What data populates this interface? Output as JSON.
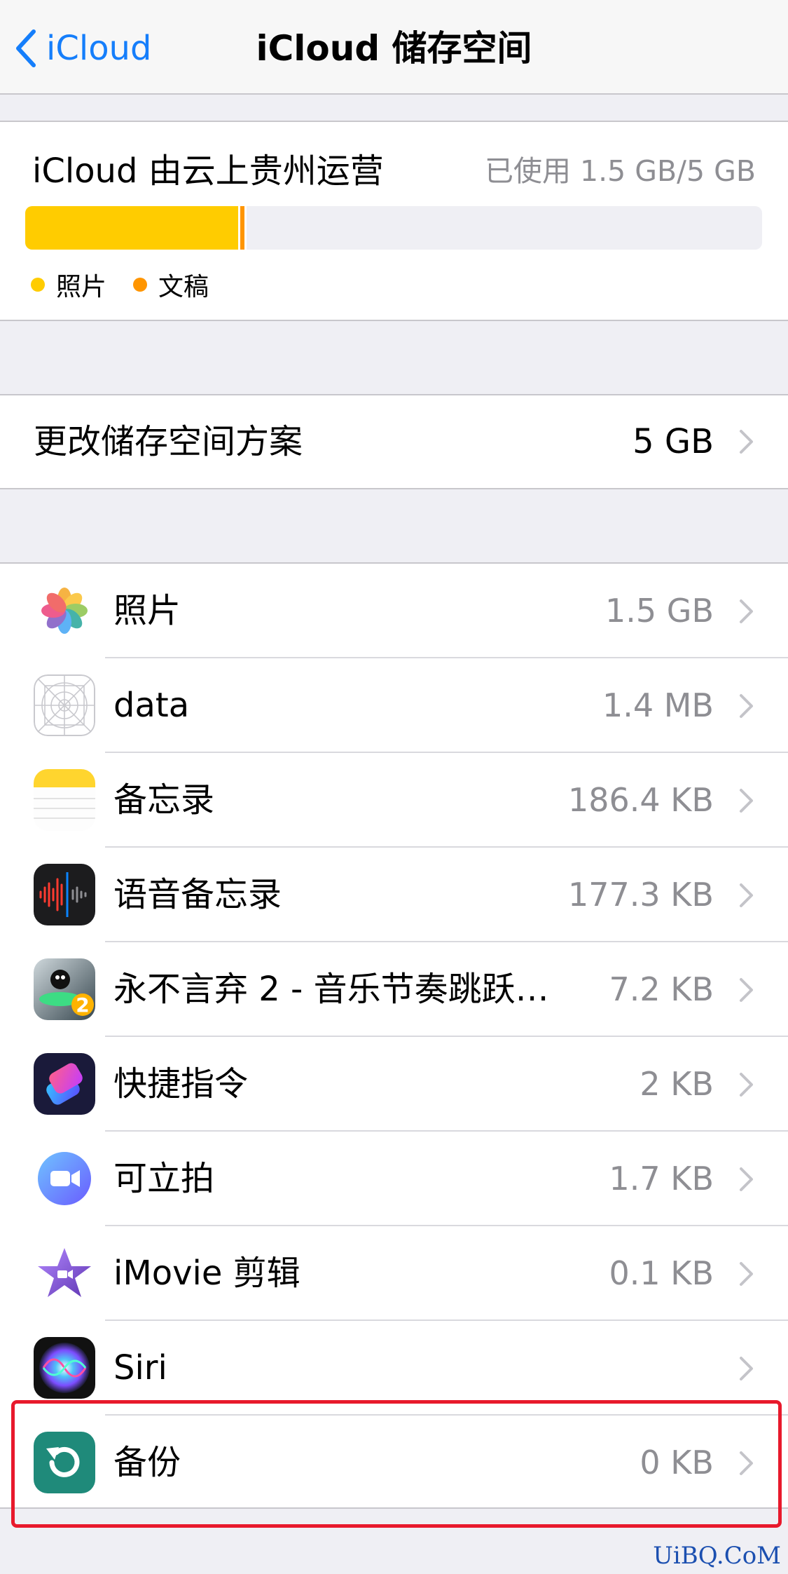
{
  "nav": {
    "back_label": "iCloud",
    "title": "iCloud 储存空间"
  },
  "storage": {
    "provider": "iCloud 由云上贵州运营",
    "used_text": "已使用 1.5 GB/5 GB",
    "usage_fraction": 0.3,
    "segments": [
      {
        "name": "照片",
        "fraction": 0.289,
        "color": "#ffcc00"
      },
      {
        "name": "文稿",
        "fraction": 0.006,
        "color": "#ff9500"
      }
    ],
    "legend": [
      {
        "label": "照片",
        "color": "#ffcc00"
      },
      {
        "label": "文稿",
        "color": "#ff9500"
      }
    ]
  },
  "plan": {
    "label": "更改储存空间方案",
    "value": "5 GB"
  },
  "apps": [
    {
      "name": "照片",
      "size": "1.5 GB",
      "icon": "photos-icon"
    },
    {
      "name": "data",
      "size": "1.4 MB",
      "icon": "app-placeholder-icon"
    },
    {
      "name": "备忘录",
      "size": "186.4 KB",
      "icon": "notes-icon"
    },
    {
      "name": "语音备忘录",
      "size": "177.3 KB",
      "icon": "voice-memos-icon"
    },
    {
      "name": "永不言弃 2 - 音乐节奏跳跃…",
      "size": "7.2 KB",
      "icon": "game-icon"
    },
    {
      "name": "快捷指令",
      "size": "2 KB",
      "icon": "shortcuts-icon"
    },
    {
      "name": "可立拍",
      "size": "1.7 KB",
      "icon": "clips-icon"
    },
    {
      "name": "iMovie 剪辑",
      "size": "0.1 KB",
      "icon": "imovie-icon"
    },
    {
      "name": "Siri",
      "size": "",
      "icon": "siri-icon"
    },
    {
      "name": "备份",
      "size": "0 KB",
      "icon": "backup-icon"
    }
  ],
  "watermark": "UiBQ.CoM"
}
